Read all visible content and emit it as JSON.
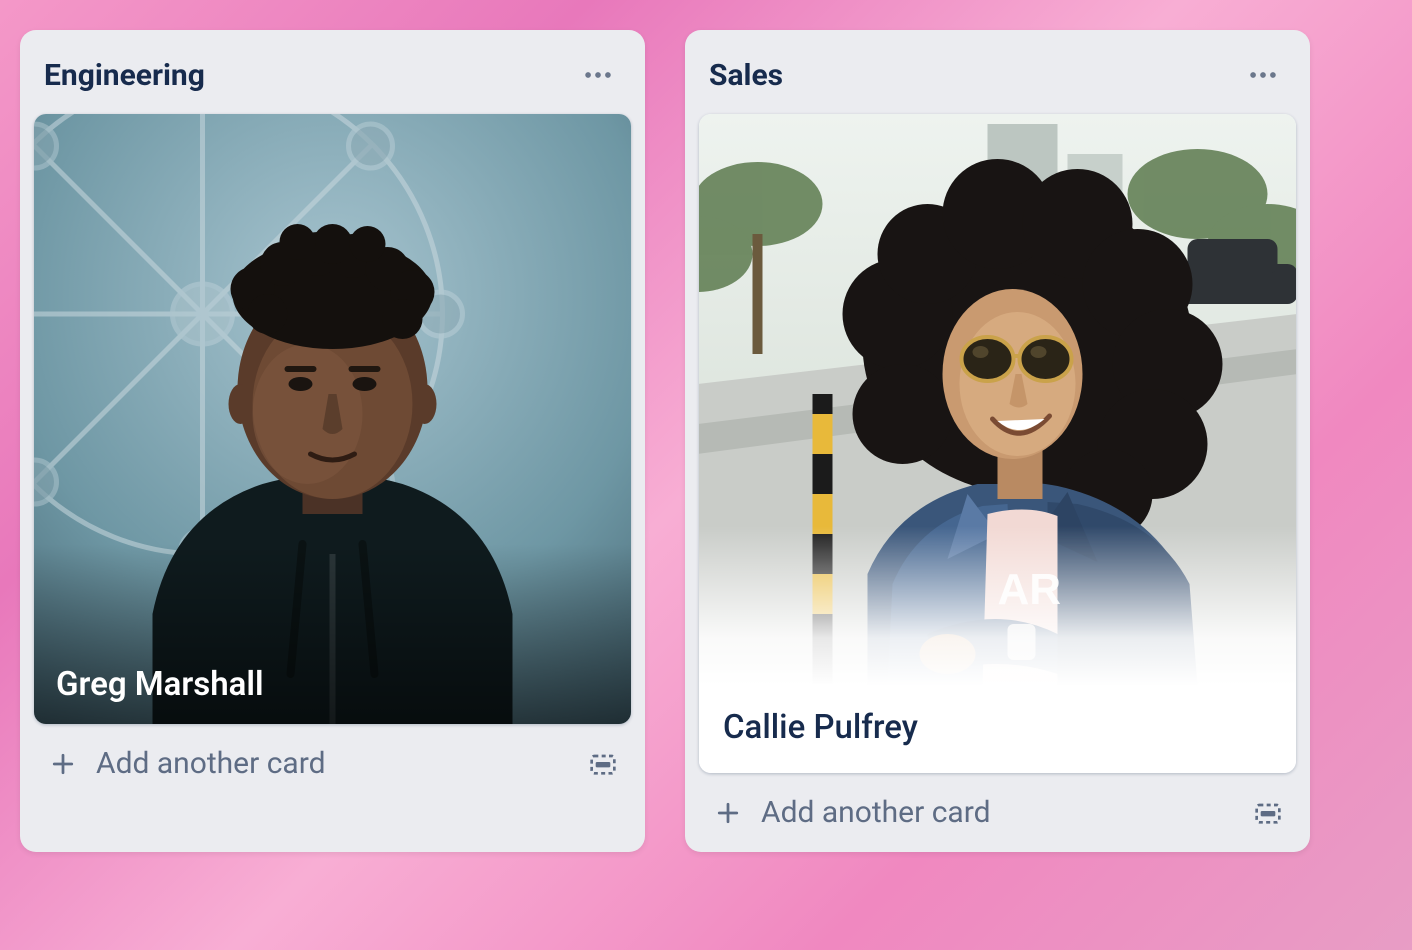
{
  "lists": [
    {
      "title": "Engineering",
      "card": {
        "name": "Greg Marshall",
        "overlay": true
      },
      "add_label": "Add another card"
    },
    {
      "title": "Sales",
      "card": {
        "name": "Callie Pulfrey",
        "overlay": false
      },
      "add_label": "Add another card"
    }
  ],
  "icons": {
    "more": "more-horizontal-icon",
    "plus": "plus-icon",
    "template": "template-icon"
  }
}
